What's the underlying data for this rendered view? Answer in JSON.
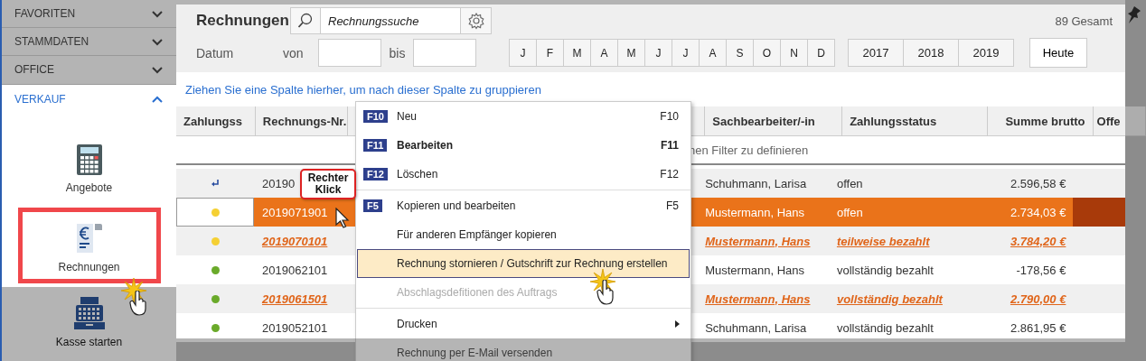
{
  "sidebar": {
    "sections": [
      {
        "label": "FAVORITEN",
        "expanded": false
      },
      {
        "label": "STAMMDATEN",
        "expanded": false
      },
      {
        "label": "OFFICE",
        "expanded": false
      },
      {
        "label": "VERKAUF",
        "expanded": true,
        "items": [
          {
            "label": "Angebote",
            "kind": "calculator",
            "selected": false,
            "dimmed": false
          },
          {
            "label": "Rechnungen",
            "kind": "invoice",
            "selected": true,
            "dimmed": false
          },
          {
            "label": "Kasse starten",
            "kind": "register",
            "selected": false,
            "dimmed": true
          }
        ]
      }
    ]
  },
  "toolbar": {
    "title": "Rechnungen",
    "search": {
      "placeholder": "Rechnungssuche"
    },
    "total": "89 Gesamt",
    "date_label": "Datum",
    "from_label": "von",
    "to_label": "bis",
    "months": [
      "J",
      "F",
      "M",
      "A",
      "M",
      "J",
      "J",
      "A",
      "S",
      "O",
      "N",
      "D"
    ],
    "years": [
      "2017",
      "2018",
      "2019"
    ],
    "today": "Heute"
  },
  "group_hint": "Ziehen Sie eine Spalte hierher, um nach dieser Spalte zu gruppieren",
  "table": {
    "columns": [
      "Zahlungss",
      "Rechnungs-Nr.",
      "Sachbearbeiter/-in",
      "Zahlungsstatus",
      "Summe brutto",
      "Offe"
    ],
    "filter_hint": "nen Filter zu definieren",
    "rows": [
      {
        "status": {
          "kind": "arrow"
        },
        "number": "20190",
        "clerk": "Schuhmann, Larisa",
        "payment": "offen",
        "total": "2.596,58 €",
        "kind": "normal",
        "selected": false
      },
      {
        "status": {
          "kind": "dot",
          "color": "#f5d033"
        },
        "number": "2019071901",
        "clerk": "Mustermann, Hans",
        "payment": "offen",
        "total": "2.734,03 €",
        "kind": "normal",
        "selected": true
      },
      {
        "status": {
          "kind": "dot",
          "color": "#f5d033"
        },
        "number": "2019070101",
        "clerk": "Mustermann, Hans",
        "payment": "teilweise bezahlt",
        "total": "3.784,20 €",
        "kind": "overdue",
        "selected": false
      },
      {
        "status": {
          "kind": "dot",
          "color": "#6aaa2a"
        },
        "number": "2019062101",
        "clerk": "Mustermann, Hans",
        "payment": "vollständig bezahlt",
        "total": "-178,56 €",
        "kind": "normal",
        "selected": false
      },
      {
        "status": {
          "kind": "dot",
          "color": "#6aaa2a"
        },
        "number": "2019061501",
        "clerk": "Mustermann, Hans",
        "payment": "vollständig bezahlt",
        "total": "2.790,00 €",
        "kind": "overdue",
        "selected": false
      },
      {
        "status": {
          "kind": "dot",
          "color": "#6aaa2a"
        },
        "number": "2019052101",
        "clerk": "Schuhmann, Larisa",
        "payment": "vollständig bezahlt",
        "total": "2.861,95 €",
        "kind": "normal",
        "selected": false
      }
    ]
  },
  "context_menu": {
    "items": [
      {
        "kind": "item",
        "badge": "F10",
        "label": "Neu",
        "shortcut": "F10",
        "bold": false,
        "disabled": false,
        "highlighted": false
      },
      {
        "kind": "item",
        "badge": "F11",
        "label": "Bearbeiten",
        "shortcut": "F11",
        "bold": true,
        "disabled": false,
        "highlighted": false
      },
      {
        "kind": "item",
        "badge": "F12",
        "label": "Löschen",
        "shortcut": "F12",
        "bold": false,
        "disabled": false,
        "highlighted": false
      },
      {
        "kind": "separator"
      },
      {
        "kind": "item",
        "badge": "F5",
        "label": "Kopieren und bearbeiten",
        "shortcut": "F5",
        "bold": false,
        "disabled": false,
        "highlighted": false
      },
      {
        "kind": "item",
        "label": "Für anderen Empfänger kopieren",
        "bold": false,
        "disabled": false,
        "highlighted": false
      },
      {
        "kind": "item",
        "label": "Rechnung stornieren / Gutschrift zur Rechnung erstellen",
        "bold": false,
        "disabled": false,
        "highlighted": true
      },
      {
        "kind": "item",
        "label": "Abschlagsdefitionen des Auftrags",
        "bold": false,
        "disabled": true,
        "highlighted": false
      },
      {
        "kind": "separator"
      },
      {
        "kind": "submenu",
        "label": "Drucken",
        "bold": false,
        "disabled": false,
        "highlighted": false
      },
      {
        "kind": "item",
        "label": "Rechnung per E-Mail versenden",
        "bold": false,
        "disabled": false,
        "highlighted": false
      }
    ]
  },
  "callout": {
    "text": "Rechter Klick"
  }
}
